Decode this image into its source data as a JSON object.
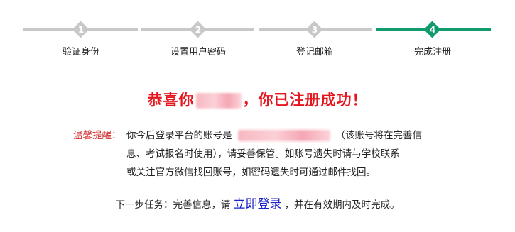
{
  "steps": [
    {
      "number": "1",
      "label": "验证身份",
      "active": false
    },
    {
      "number": "2",
      "label": "设置用户密码",
      "active": false
    },
    {
      "number": "3",
      "label": "登记邮箱",
      "active": false
    },
    {
      "number": "4",
      "label": "完成注册",
      "active": true
    }
  ],
  "success": {
    "prefix": "恭喜你",
    "suffix": "，你已注册成功！"
  },
  "tip": {
    "label": "温馨提醒：",
    "line1_before": "你今后登录平台的账号是",
    "line1_after": "（该账号将在完善信",
    "line2": "息、考试报名时使用），请妥善保管。如账号遗失时请与学校联系",
    "line3": "或关注官方微信找回账号，如密码遗失时可通过邮件找回。"
  },
  "next": {
    "before": "下一步任务：完善信息，请",
    "link": "立即登录",
    "after": "，并在有效期内及时完成。"
  },
  "colors": {
    "active": "#119a6d",
    "inactive": "#c8c8c8",
    "success": "#e5161e",
    "tip_label": "#d02a2a",
    "link": "#1a22c8"
  }
}
